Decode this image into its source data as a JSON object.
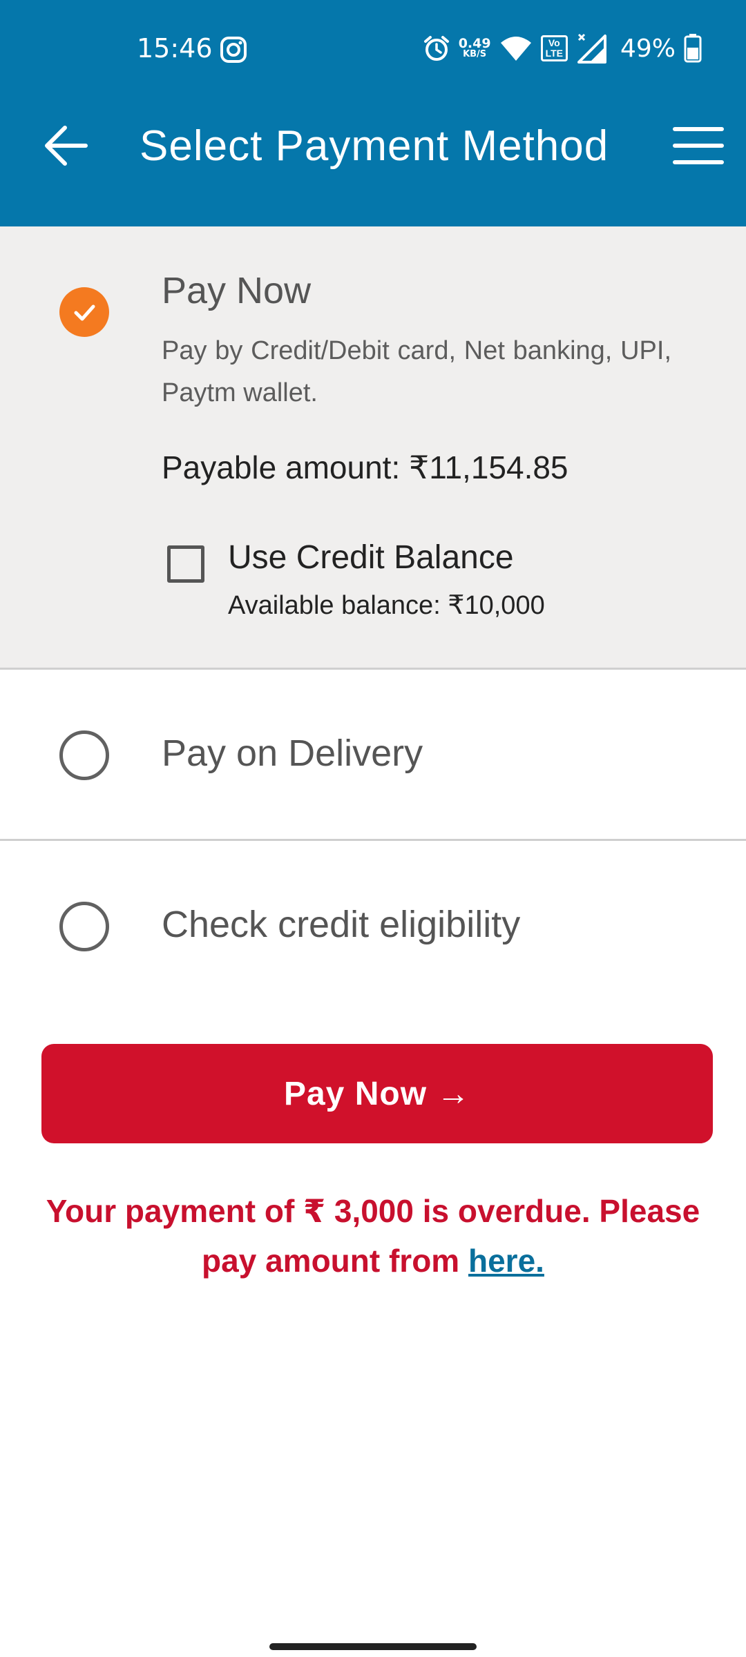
{
  "status_bar": {
    "time": "15:46",
    "net_speed_value": "0.49",
    "net_speed_unit": "KB/S",
    "volte_top": "Vo",
    "volte_bottom": "LTE",
    "battery_percent": "49%",
    "icons": [
      "instagram-icon",
      "alarm-icon",
      "wifi-icon",
      "volte-icon",
      "signal-icon",
      "battery-icon"
    ]
  },
  "header": {
    "title": "Select Payment Method",
    "background_color": "#0577ab"
  },
  "options": {
    "pay_now": {
      "title": "Pay Now",
      "selected": true,
      "description": "Pay by Credit/Debit card, Net banking, UPI, Paytm wallet.",
      "payable_label": "Payable amount:",
      "payable_value": "₹11,154.85",
      "credit_balance_label": "Use Credit Balance",
      "credit_balance_checked": false,
      "available_balance": "Available balance: ₹10,000"
    },
    "pay_on_delivery": {
      "title": "Pay on Delivery",
      "selected": false
    },
    "check_credit": {
      "title": "Check credit eligibility",
      "selected": false
    }
  },
  "pay_button": {
    "label": "Pay Now",
    "arrow": "→",
    "color": "#d0112b"
  },
  "overdue_notice": {
    "line1": "Your payment of ₹ 3,000 is overdue. Please",
    "line2_prefix": "pay amount from ",
    "link_text": "here.",
    "color": "#c8102e",
    "link_color": "#0a6f9c"
  },
  "colors": {
    "selected_radio": "#f47a20",
    "selected_background": "#f0efee"
  }
}
